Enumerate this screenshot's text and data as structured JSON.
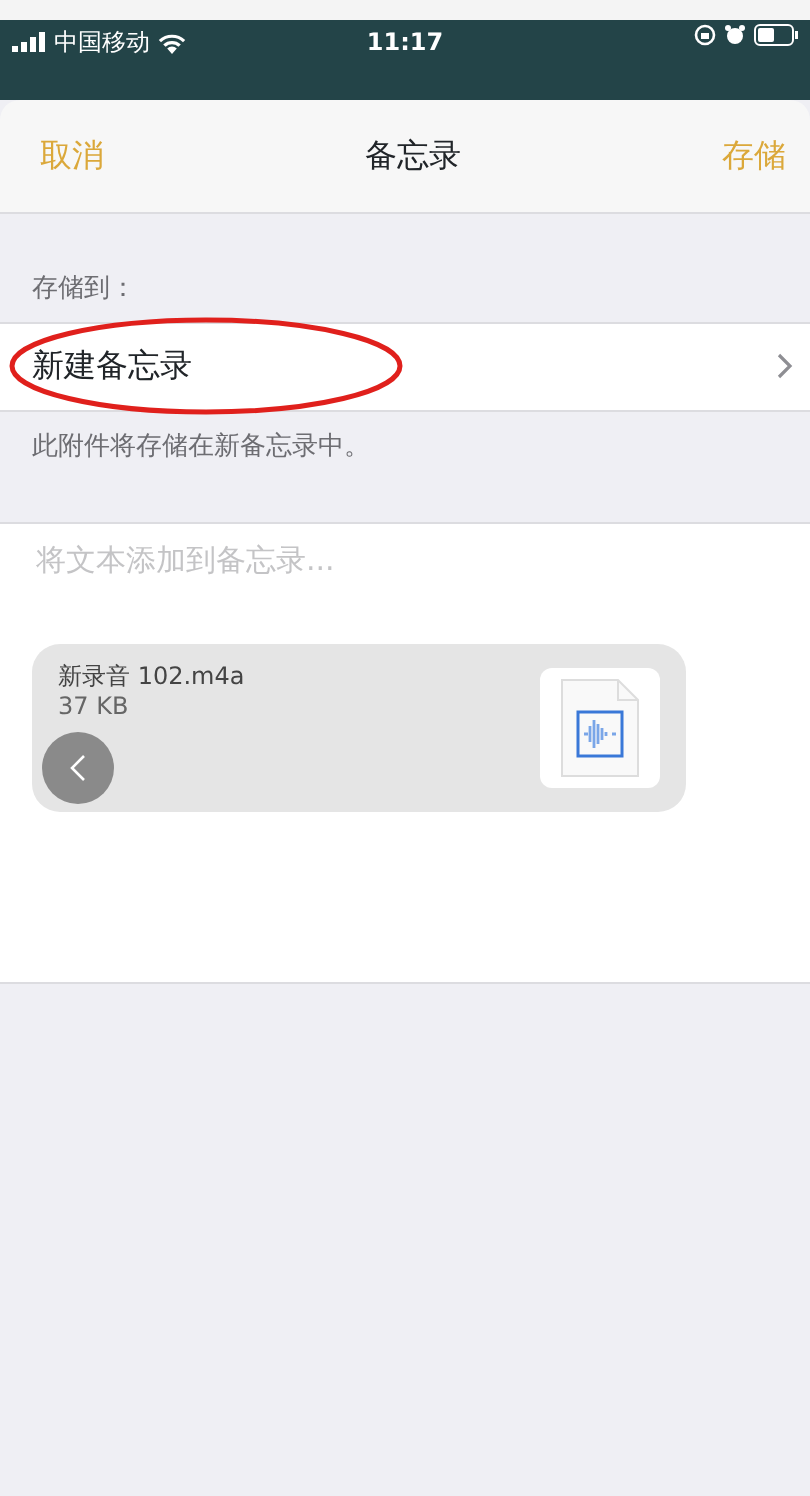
{
  "status_bar": {
    "carrier": "中国移动",
    "time": "11:17"
  },
  "nav": {
    "cancel": "取消",
    "title": "备忘录",
    "save": "存储"
  },
  "save_to": {
    "header": "存储到：",
    "row_label": "新建备忘录",
    "footer": "此附件将存储在新备忘录中。",
    "highlighted": true
  },
  "note": {
    "placeholder": "将文本添加到备忘录..."
  },
  "attachment": {
    "name": "新录音 102.m4a",
    "size": "37 KB"
  }
}
